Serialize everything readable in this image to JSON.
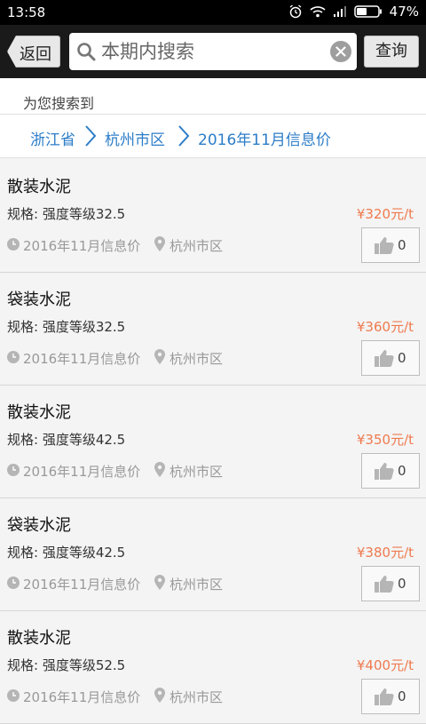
{
  "status_bar": {
    "time": "13:58",
    "battery": "47%"
  },
  "toolbar": {
    "back_label": "返回",
    "search_placeholder": "本期内搜索",
    "query_label": "查询"
  },
  "result_hint": "为您搜索到",
  "breadcrumb": [
    "浙江省",
    "杭州市区",
    "2016年11月信息价"
  ],
  "items": [
    {
      "name": "散装水泥",
      "spec": "规格: 强度等级32.5",
      "price": "¥320元/t",
      "date": "2016年11月信息价",
      "location": "杭州市区",
      "likes": "0"
    },
    {
      "name": "袋装水泥",
      "spec": "规格: 强度等级32.5",
      "price": "¥360元/t",
      "date": "2016年11月信息价",
      "location": "杭州市区",
      "likes": "0"
    },
    {
      "name": "散装水泥",
      "spec": "规格: 强度等级42.5",
      "price": "¥350元/t",
      "date": "2016年11月信息价",
      "location": "杭州市区",
      "likes": "0"
    },
    {
      "name": "袋装水泥",
      "spec": "规格: 强度等级42.5",
      "price": "¥380元/t",
      "date": "2016年11月信息价",
      "location": "杭州市区",
      "likes": "0"
    },
    {
      "name": "散装水泥",
      "spec": "规格: 强度等级52.5",
      "price": "¥400元/t",
      "date": "2016年11月信息价",
      "location": "杭州市区",
      "likes": "0"
    }
  ]
}
